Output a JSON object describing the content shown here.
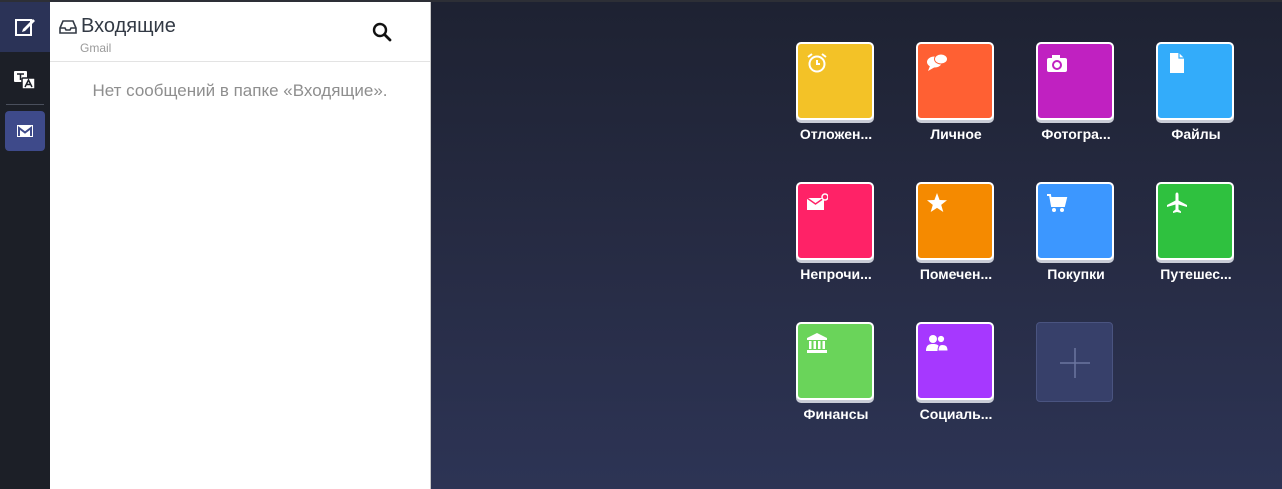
{
  "inbox": {
    "title": "Входящие",
    "account": "Gmail",
    "empty_message": "Нет сообщений в папке «Входящие»."
  },
  "tiles": [
    {
      "label": "Отложен...",
      "color": "#f3c227",
      "icon": "alarm-clock-icon"
    },
    {
      "label": "Личное",
      "color": "#ff6033",
      "icon": "chat-bubbles-icon"
    },
    {
      "label": "Фотогра...",
      "color": "#c021c1",
      "icon": "camera-icon"
    },
    {
      "label": "Файлы",
      "color": "#33acfa",
      "icon": "file-icon"
    },
    {
      "label": "Непрочи...",
      "color": "#ff2267",
      "icon": "unread-envelope-icon"
    },
    {
      "label": "Помечен...",
      "color": "#f58a00",
      "icon": "star-icon"
    },
    {
      "label": "Покупки",
      "color": "#3c97ff",
      "icon": "shopping-cart-icon"
    },
    {
      "label": "Путешес...",
      "color": "#2fc13f",
      "icon": "airplane-icon"
    },
    {
      "label": "Финансы",
      "color": "#6ad45a",
      "icon": "bank-icon"
    },
    {
      "label": "Социаль...",
      "color": "#a638ff",
      "icon": "people-icon"
    }
  ],
  "add_tile": {
    "icon": "plus-icon"
  }
}
